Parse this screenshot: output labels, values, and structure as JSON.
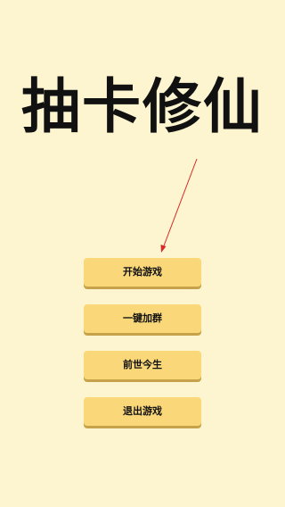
{
  "title": "抽卡修仙",
  "menu": {
    "start_label": "开始游戏",
    "join_group_label": "一键加群",
    "past_life_label": "前世今生",
    "exit_label": "退出游戏"
  },
  "colors": {
    "background": "#fdf5cf",
    "button": "#fad879",
    "button_shadow": "#c6a24a",
    "arrow": "#d62a2a"
  },
  "icons": {
    "pointer": "red-arrow-icon"
  }
}
